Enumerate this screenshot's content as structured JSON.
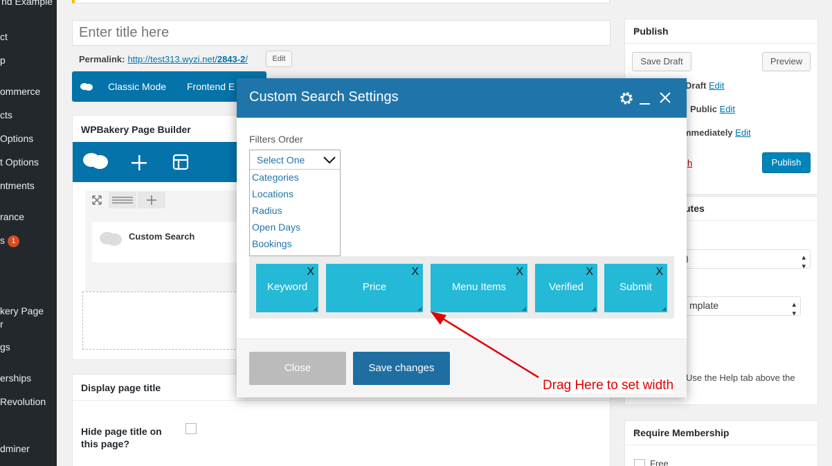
{
  "sidebar": {
    "items": [
      {
        "label": "rid Example"
      },
      {
        "label": "ct"
      },
      {
        "label": "p"
      },
      {
        "label": "ommerce"
      },
      {
        "label": "cts"
      },
      {
        "label": "Options"
      },
      {
        "label": "t Options"
      },
      {
        "label": "ntments"
      },
      {
        "label": "rance"
      },
      {
        "label": "s",
        "badge": "1"
      },
      {
        "label": "kery Page"
      },
      {
        "label": "r"
      },
      {
        "label": "gs"
      },
      {
        "label": "erships"
      },
      {
        "label": "Revolution"
      },
      {
        "label": "dminer"
      }
    ]
  },
  "editor": {
    "title_placeholder": "Enter title here",
    "permalink_label": "Permalink:",
    "permalink_url_base": "http://test313.wyzi.net/",
    "permalink_url_slug": "2843-2",
    "permalink_url_end": "/",
    "permalink_edit": "Edit"
  },
  "vc_bar": {
    "classic_mode": "Classic Mode",
    "frontend": "Frontend E"
  },
  "builder": {
    "title": "WPBakery Page Builder",
    "element_label": "Custom Search"
  },
  "display_title": {
    "heading": "Display page title",
    "hide_label": "Hide page title on this page?"
  },
  "publish": {
    "heading": "Publish",
    "save_draft": "Save Draft",
    "preview": "Preview",
    "status_suffix": "Draft",
    "status_edit": "Edit",
    "visibility_suffix": "Public",
    "visibility_edit": "Edit",
    "schedule_suffix": "mmediately",
    "schedule_edit": "Edit",
    "trash_suffix": "h",
    "publish_button": "Publish"
  },
  "page_attributes": {
    "heading_suffix": "utes",
    "parent_value": ")",
    "template_value": "mplate",
    "help_text": "Use the Help tab above the"
  },
  "membership": {
    "heading": "Require Membership",
    "option_free": "Free"
  },
  "modal": {
    "title": "Custom Search Settings",
    "filters_label": "Filters Order",
    "select_value": "Select One",
    "options": [
      "Categories",
      "Locations",
      "Radius",
      "Open Days",
      "Bookings"
    ],
    "chips": [
      {
        "label": "Keyword",
        "remove": "X"
      },
      {
        "label": "Price",
        "remove": "X"
      },
      {
        "label": "Menu Items",
        "remove": "X"
      },
      {
        "label": "Verified",
        "remove": "X"
      },
      {
        "label": "Submit",
        "remove": "X"
      }
    ],
    "close_button": "Close",
    "save_button": "Save changes"
  },
  "annotation": {
    "text": "Drag Here to set width",
    "color": "#e00000"
  },
  "colors": {
    "wp_blue": "#0473aa",
    "modal_header": "#1f75aa",
    "chip": "#24b9d7",
    "publish_button": "#0085ba"
  }
}
